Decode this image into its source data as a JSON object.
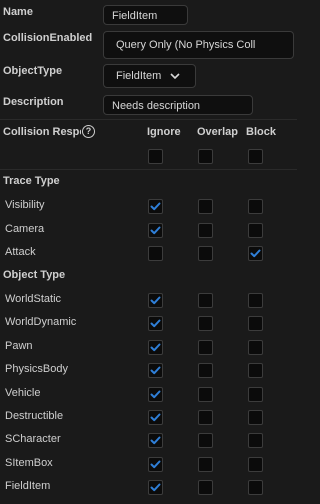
{
  "fields": {
    "name_label": "Name",
    "name_value": "FieldItem",
    "collision_enabled_label": "CollisionEnabled",
    "collision_enabled_value": "Query Only (No Physics Coll",
    "object_type_label": "ObjectType",
    "object_type_value": "FieldItem",
    "description_label": "Description",
    "description_value": "Needs description"
  },
  "responses": {
    "label": "Collision Respo",
    "columns": [
      "Ignore",
      "Overlap",
      "Block"
    ]
  },
  "trace_type": {
    "label": "Trace Type",
    "rows": [
      {
        "name": "Visibility",
        "checked": [
          true,
          false,
          false
        ]
      },
      {
        "name": "Camera",
        "checked": [
          true,
          false,
          false
        ]
      },
      {
        "name": "Attack",
        "checked": [
          false,
          false,
          true
        ]
      }
    ]
  },
  "object_type": {
    "label": "Object Type",
    "rows": [
      {
        "name": "WorldStatic",
        "checked": [
          true,
          false,
          false
        ]
      },
      {
        "name": "WorldDynamic",
        "checked": [
          true,
          false,
          false
        ]
      },
      {
        "name": "Pawn",
        "checked": [
          true,
          false,
          false
        ]
      },
      {
        "name": "PhysicsBody",
        "checked": [
          true,
          false,
          false
        ]
      },
      {
        "name": "Vehicle",
        "checked": [
          true,
          false,
          false
        ]
      },
      {
        "name": "Destructible",
        "checked": [
          true,
          false,
          false
        ]
      },
      {
        "name": "SCharacter",
        "checked": [
          true,
          false,
          false
        ]
      },
      {
        "name": "SItemBox",
        "checked": [
          true,
          false,
          false
        ]
      },
      {
        "name": "FieldItem",
        "checked": [
          true,
          false,
          false
        ]
      }
    ]
  },
  "colors": {
    "accent": "#2f7fd8",
    "background": "#1a1a1a"
  },
  "icons": {
    "help": "help-circle-icon",
    "dropdown": "chevron-down-icon",
    "check": "checkmark-icon"
  }
}
